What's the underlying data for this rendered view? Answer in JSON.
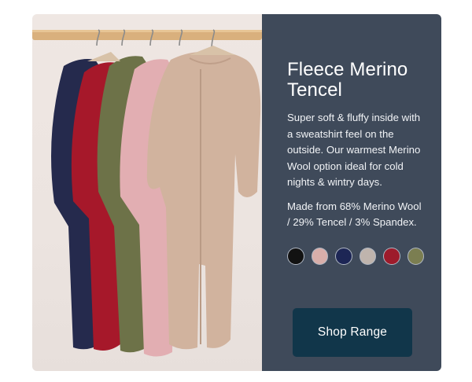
{
  "product": {
    "title": "Fleece Merino Tencel",
    "description": "Super soft & fluffy inside with a sweatshirt feel on the outside. Our warmest Merino Wool option ideal for cold nights & wintry days.",
    "composition": "Made from 68% Merino Wool / 29% Tencel / 3% Spandex.",
    "image_icon": "garments-on-rail-photo"
  },
  "swatches": [
    {
      "name": "black",
      "color": "#121212"
    },
    {
      "name": "pink",
      "color": "#d8aeaa"
    },
    {
      "name": "navy",
      "color": "#1d2655"
    },
    {
      "name": "oatmeal",
      "color": "#bfb4ad"
    },
    {
      "name": "burgundy",
      "color": "#9d1b2b"
    },
    {
      "name": "olive",
      "color": "#7b7e51"
    }
  ],
  "cta": {
    "label": "Shop Range"
  },
  "colors": {
    "panel": "#3f4a5a",
    "button": "#11364a"
  }
}
